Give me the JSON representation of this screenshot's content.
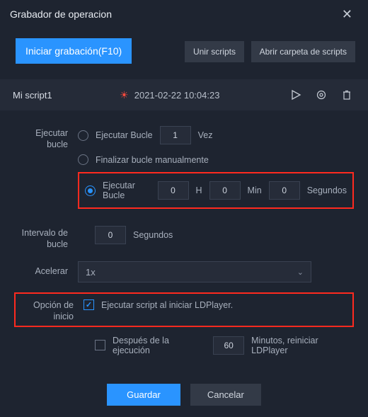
{
  "window": {
    "title": "Grabador de operacion"
  },
  "top": {
    "start_label": "Iniciar grabación(F10)",
    "join_label": "Unir scripts",
    "open_folder_label": "Abrir carpeta de scripts"
  },
  "script": {
    "name": "Mi script1",
    "timestamp": "2021-02-22 10:04:23"
  },
  "labels": {
    "loop": "Ejecutar bucle",
    "interval": "Intervalo de bucle",
    "accel": "Acelerar",
    "startopt": "Opción de inicio"
  },
  "loop": {
    "opt1_label": "Ejecutar Bucle",
    "opt1_value": "1",
    "opt1_unit": "Vez",
    "opt2_label": "Finalizar bucle manualmente",
    "opt3_label": "Ejecutar Bucle",
    "h_val": "0",
    "h_unit": "H",
    "m_val": "0",
    "m_unit": "Min",
    "s_val": "0",
    "s_unit": "Segundos"
  },
  "interval": {
    "value": "0",
    "unit": "Segundos"
  },
  "accel": {
    "value": "1x"
  },
  "startopt": {
    "run_on_start": "Ejecutar script al iniciar LDPlayer.",
    "after_exec": "Después de la ejecución",
    "after_val": "60",
    "after_unit": "Minutos, reiniciar LDPlayer"
  },
  "footer": {
    "save": "Guardar",
    "cancel": "Cancelar"
  }
}
